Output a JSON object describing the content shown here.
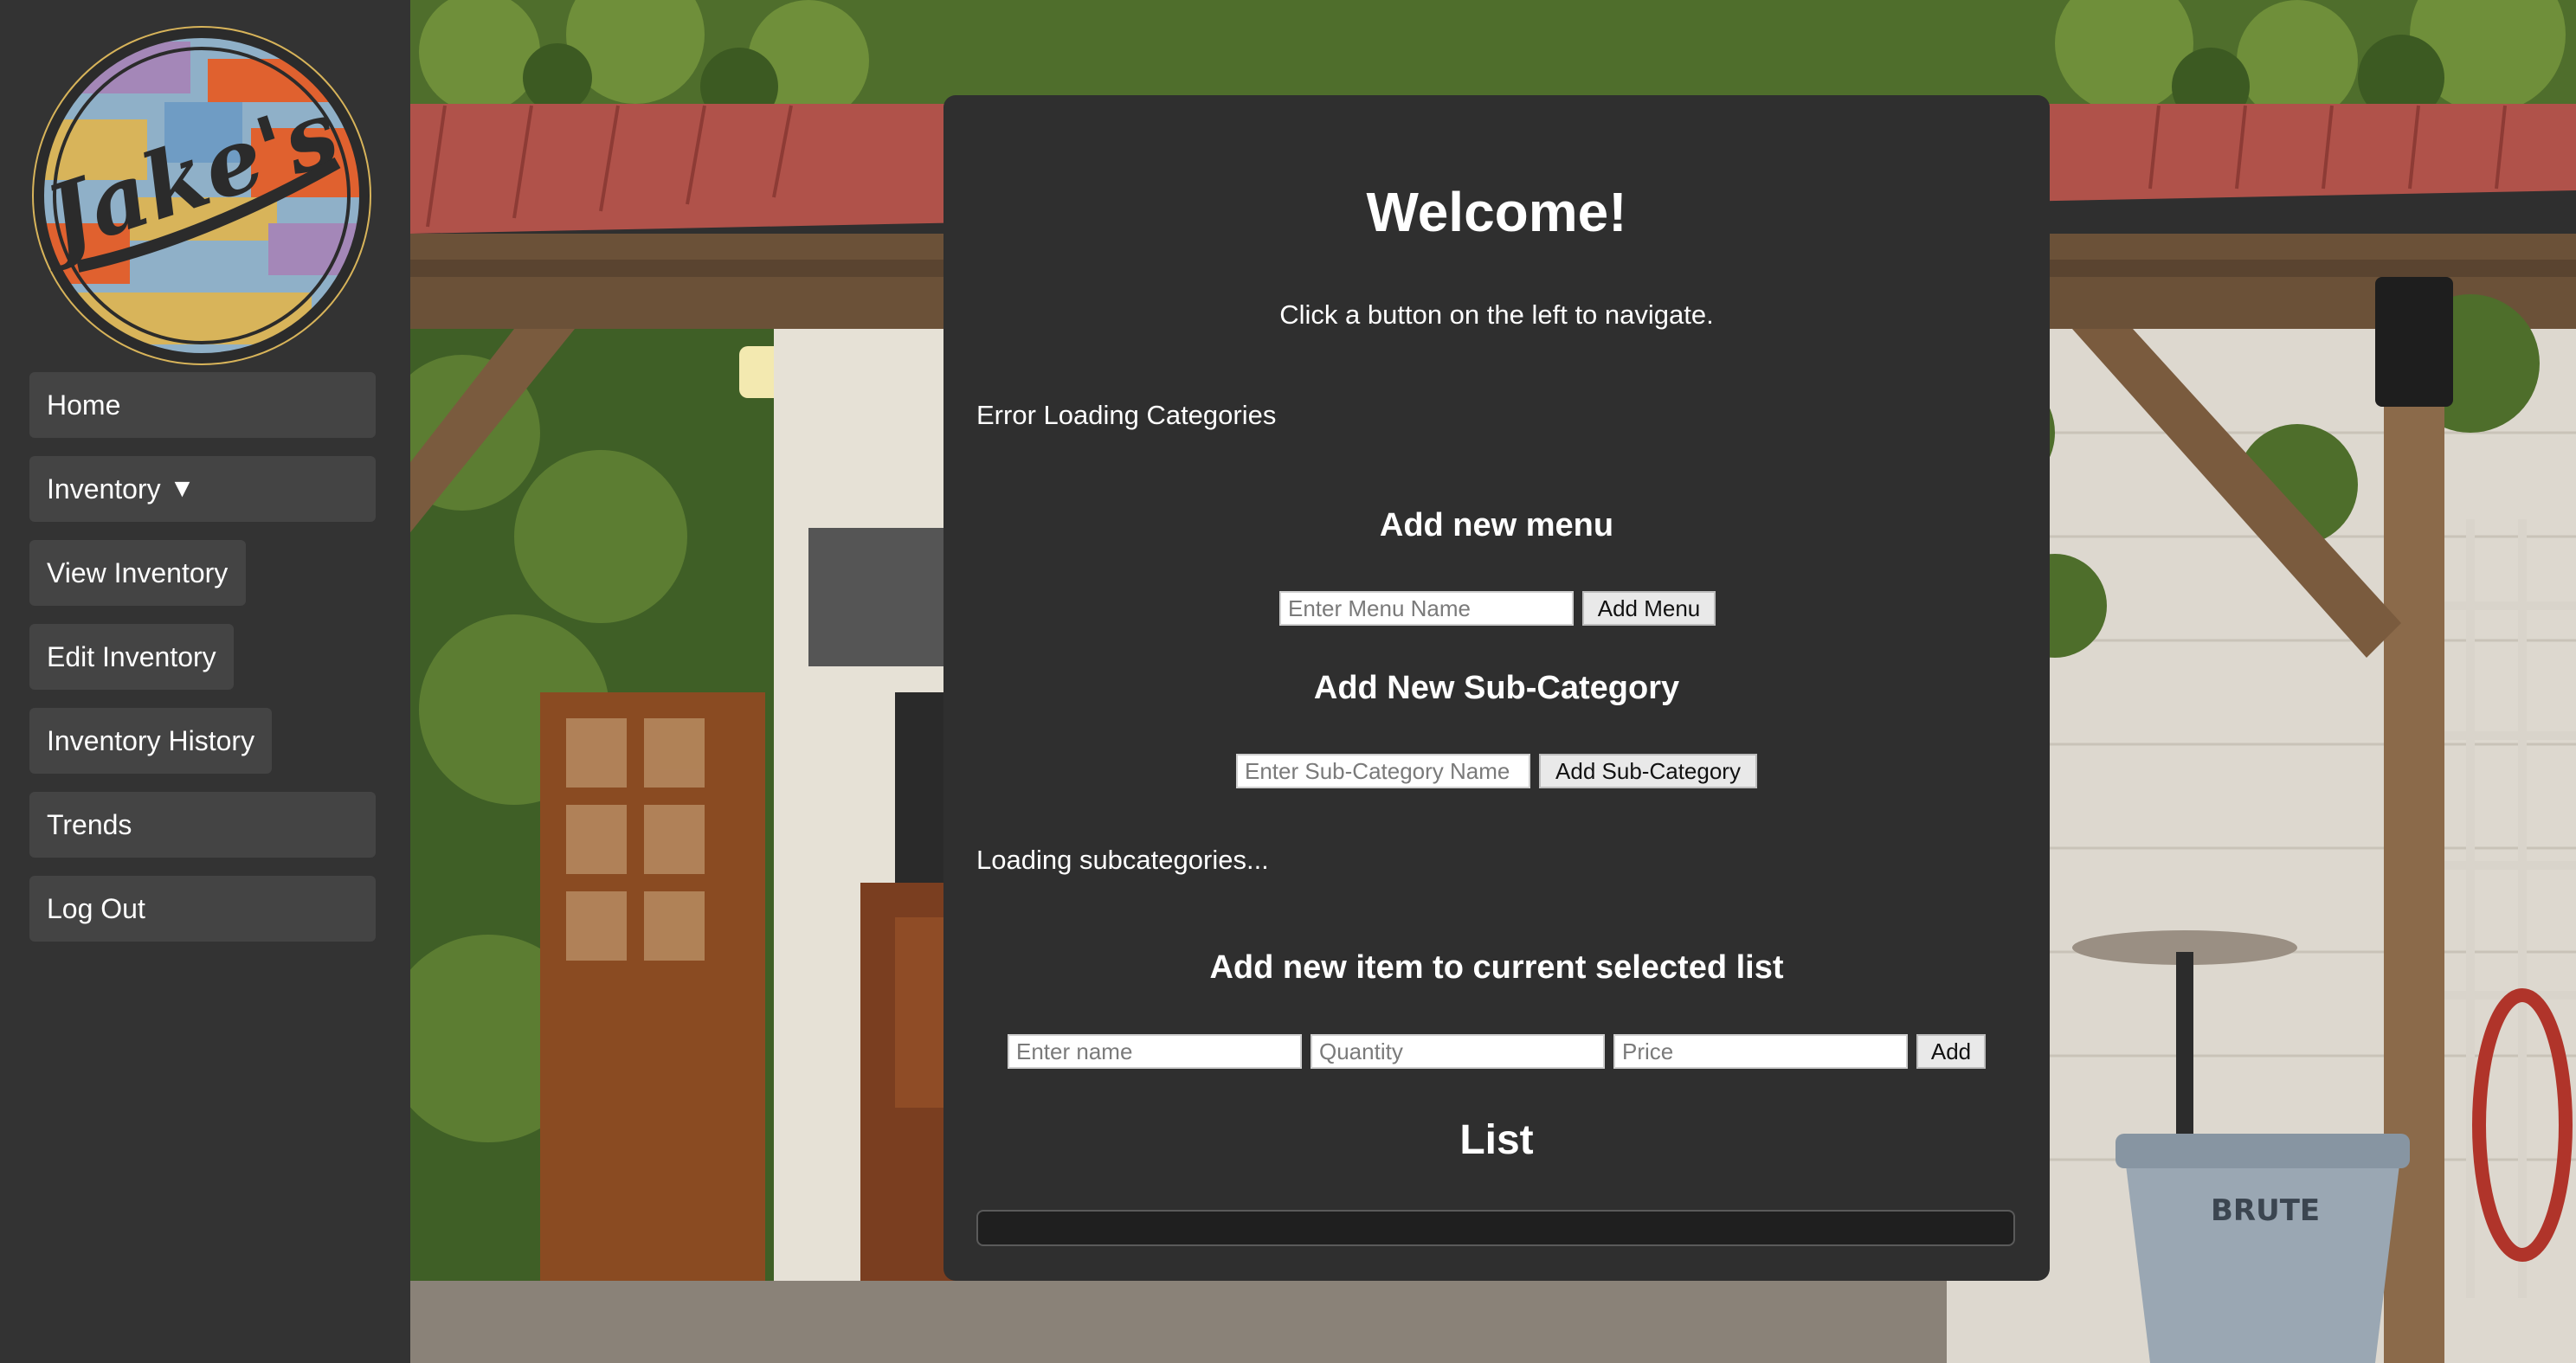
{
  "sidebar": {
    "logo_text": "Jake's",
    "items": [
      {
        "label": "Home"
      },
      {
        "label": "Inventory",
        "caret": "▼"
      },
      {
        "label": "View Inventory"
      },
      {
        "label": "Edit Inventory"
      },
      {
        "label": "Inventory History"
      },
      {
        "label": "Trends"
      },
      {
        "label": "Log Out"
      }
    ]
  },
  "main": {
    "title": "Welcome!",
    "subtitle": "Click a button on the left to navigate.",
    "categories_status": "Error Loading Categories",
    "menu_section": {
      "heading": "Add new menu",
      "input_placeholder": "Enter Menu Name",
      "button_label": "Add Menu"
    },
    "subcategory_section": {
      "heading": "Add New Sub-Category",
      "input_placeholder": "Enter Sub-Category Name",
      "button_label": "Add Sub-Category"
    },
    "subcategories_status": "Loading subcategories...",
    "item_section": {
      "heading": "Add new item to current selected list",
      "name_placeholder": "Enter name",
      "quantity_placeholder": "Quantity",
      "price_placeholder": "Price",
      "button_label": "Add"
    },
    "list_heading": "List"
  },
  "colors": {
    "sidebar_bg": "#333333",
    "nav_button_bg": "#444444",
    "panel_bg": "#2f2f2f",
    "list_box_bg": "#1f1f1f"
  }
}
